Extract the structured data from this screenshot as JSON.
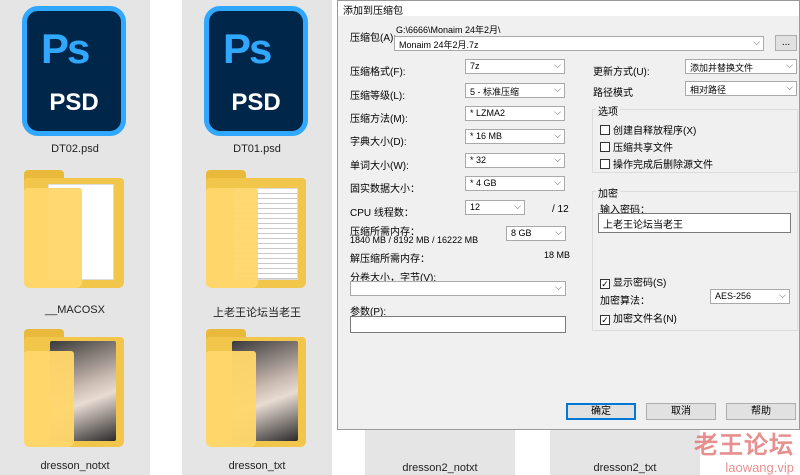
{
  "explorer": {
    "files": [
      {
        "name": "DT02.psd",
        "icon": "photoshop-file-icon"
      },
      {
        "name": "DT01.psd",
        "icon": "photoshop-file-icon"
      },
      {
        "name": "__MACOSX",
        "icon": "folder-icon"
      },
      {
        "name": "上老王论坛当老王",
        "icon": "folder-icon"
      },
      {
        "name": "dresson_notxt",
        "icon": "folder-image-icon"
      },
      {
        "name": "dresson_txt",
        "icon": "folder-image-icon"
      },
      {
        "name": "dresson2_notxt",
        "icon": "folder-image-icon"
      },
      {
        "name": "dresson2_txt",
        "icon": "folder-image-icon"
      }
    ],
    "ps_icon": {
      "top": "Ps",
      "bottom": "PSD"
    }
  },
  "dialog": {
    "title": "添加到压缩包",
    "archive_label": "压缩包(A):",
    "archive_path": "G:\\6666\\Monaim 24年2月\\",
    "archive_name": "Monaim 24年2月.7z",
    "browse_label": "...",
    "left": {
      "format_label": "压缩格式(F):",
      "format_value": "7z",
      "level_label": "压缩等级(L):",
      "level_value": "5 - 标准压缩",
      "method_label": "压缩方法(M):",
      "method_value": "* LZMA2",
      "dict_label": "字典大小(D):",
      "dict_value": "* 16 MB",
      "word_label": "单词大小(W):",
      "word_value": "* 32",
      "solid_label": "固实数据大小：",
      "solid_value": "* 4 GB",
      "threads_label": "CPU 线程数：",
      "threads_value": "12",
      "threads_total": "/ 12",
      "mem_label": "压缩所需内存：",
      "mem_detail": "1840 MB / 8192 MB / 16222 MB",
      "mem_value": "8 GB",
      "demem_label": "解压缩所需内存：",
      "demem_value": "18 MB",
      "split_label": "分卷大小，字节(V):",
      "split_value": "",
      "params_label": "参数(P):",
      "params_value": ""
    },
    "right": {
      "update_label": "更新方式(U):",
      "update_value": "添加并替换文件",
      "path_label": "路径模式",
      "path_value": "相对路径",
      "options_title": "选项",
      "options": [
        {
          "label": "创建自释放程序(X)",
          "checked": false
        },
        {
          "label": "压缩共享文件",
          "checked": false
        },
        {
          "label": "操作完成后删除源文件",
          "checked": false
        }
      ],
      "encryption_title": "加密",
      "password_label": "输入密码：",
      "password_value": "上老王论坛当老王",
      "show_password": {
        "label": "显示密码(S)",
        "checked": true
      },
      "enc_method_label": "加密算法：",
      "enc_method_value": "AES-256",
      "encrypt_names": {
        "label": "加密文件名(N)",
        "checked": true
      }
    },
    "buttons": {
      "ok": "确定",
      "cancel": "取消",
      "help": "帮助"
    }
  },
  "watermark": {
    "line1": "老王论坛",
    "line2": "laowang.vip"
  }
}
